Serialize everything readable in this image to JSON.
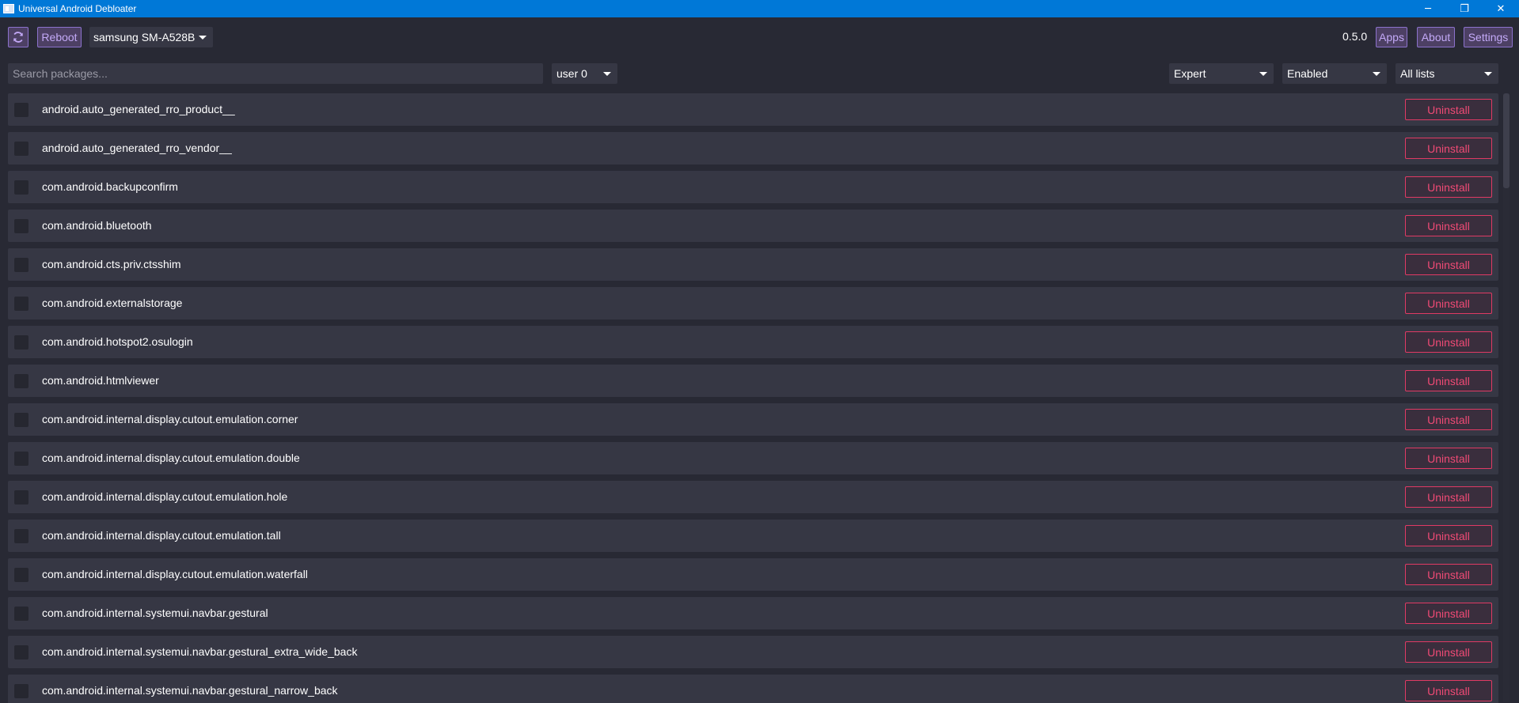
{
  "window": {
    "title": "Universal Android Debloater",
    "minimize_glyph": "─",
    "maximize_glyph": "❐",
    "close_glyph": "✕"
  },
  "toolbar": {
    "refresh_icon": "refresh-icon",
    "reboot_label": "Reboot",
    "device": "samsung SM-A528B",
    "version": "0.5.0",
    "apps_label": "Apps",
    "about_label": "About",
    "settings_label": "Settings"
  },
  "filters": {
    "search_placeholder": "Search packages...",
    "user": "user 0",
    "mode": "Expert",
    "state": "Enabled",
    "list": "All lists"
  },
  "colors": {
    "titlebar": "#0078d7",
    "background": "#282934",
    "row": "#363744",
    "accent_purple": "#8c72cc",
    "uninstall_red": "#e03a64"
  },
  "packages": [
    {
      "name": "android.auto_generated_rro_product__",
      "action": "Uninstall"
    },
    {
      "name": "android.auto_generated_rro_vendor__",
      "action": "Uninstall"
    },
    {
      "name": "com.android.backupconfirm",
      "action": "Uninstall"
    },
    {
      "name": "com.android.bluetooth",
      "action": "Uninstall"
    },
    {
      "name": "com.android.cts.priv.ctsshim",
      "action": "Uninstall"
    },
    {
      "name": "com.android.externalstorage",
      "action": "Uninstall"
    },
    {
      "name": "com.android.hotspot2.osulogin",
      "action": "Uninstall"
    },
    {
      "name": "com.android.htmlviewer",
      "action": "Uninstall"
    },
    {
      "name": "com.android.internal.display.cutout.emulation.corner",
      "action": "Uninstall"
    },
    {
      "name": "com.android.internal.display.cutout.emulation.double",
      "action": "Uninstall"
    },
    {
      "name": "com.android.internal.display.cutout.emulation.hole",
      "action": "Uninstall"
    },
    {
      "name": "com.android.internal.display.cutout.emulation.tall",
      "action": "Uninstall"
    },
    {
      "name": "com.android.internal.display.cutout.emulation.waterfall",
      "action": "Uninstall"
    },
    {
      "name": "com.android.internal.systemui.navbar.gestural",
      "action": "Uninstall"
    },
    {
      "name": "com.android.internal.systemui.navbar.gestural_extra_wide_back",
      "action": "Uninstall"
    },
    {
      "name": "com.android.internal.systemui.navbar.gestural_narrow_back",
      "action": "Uninstall"
    }
  ]
}
